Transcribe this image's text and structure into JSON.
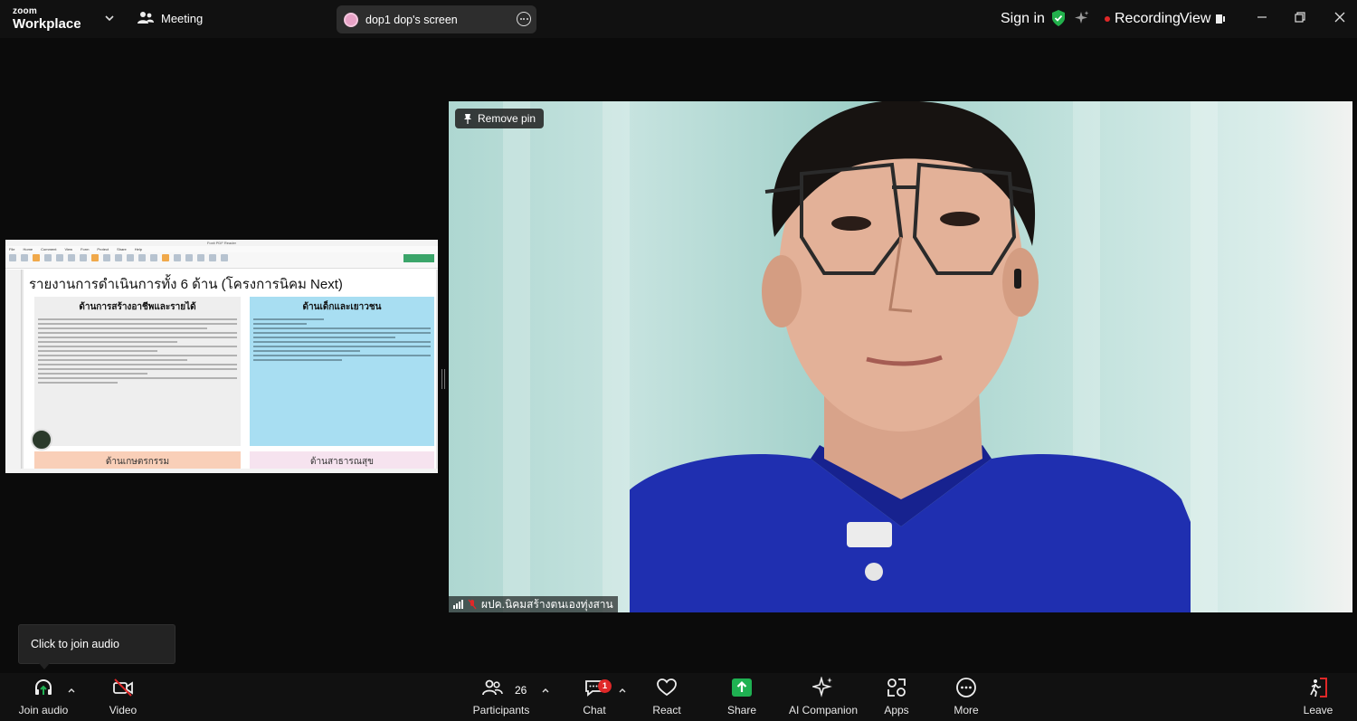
{
  "app": {
    "brand_top": "zoom",
    "brand_bottom": "Workplace",
    "meeting_label": "Meeting",
    "shared_screen_label": "dop1 dop's screen",
    "sign_in": "Sign in",
    "recording": "Recording",
    "view": "View"
  },
  "colors": {
    "background": "#0b0b0b",
    "toolbar": "#111111",
    "shield_green": "#22b14c",
    "share_green": "#1fb152",
    "recording_red": "#e02828",
    "leave_red": "#e02828"
  },
  "shared_screen": {
    "heading": "รายงานการดำเนินการทั้ง 6 ด้าน (โครงการนิคม Next)",
    "left_box_title": "ด้านการสร้างอาชีพและรายได้",
    "right_box_title": "ด้านเด็กและเยาวชน",
    "bottom_left_title": "ด้านเกษตรกรรม",
    "bottom_right_title": "ด้านสาธารณสุข"
  },
  "video": {
    "pin_label": "Remove pin",
    "participant_name": "ผปค.นิคมสร้างตนเองทุ่งสาน"
  },
  "tooltip": {
    "text": "Click to join audio"
  },
  "toolbar": {
    "join_audio": "Join audio",
    "video": "Video",
    "participants": "Participants",
    "participants_count": "26",
    "chat": "Chat",
    "chat_badge": "1",
    "react": "React",
    "share": "Share",
    "ai_companion": "AI Companion",
    "apps": "Apps",
    "more": "More",
    "leave": "Leave"
  }
}
